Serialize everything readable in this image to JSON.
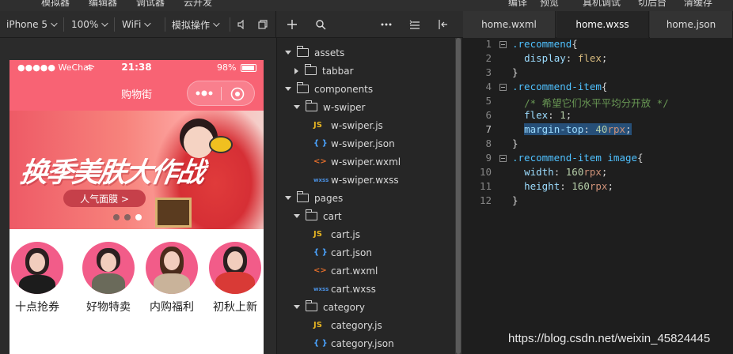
{
  "top_menu": [
    "模拟器",
    "编辑器",
    "调试器",
    "云开发",
    "编译",
    "预览",
    "真机调试",
    "切后台",
    "清缓存"
  ],
  "toolbar": {
    "device": "iPhone 5",
    "zoom": "100%",
    "network": "WiFi",
    "simulate": "模拟操作"
  },
  "tabs": [
    {
      "label": "home.wxml",
      "active": false
    },
    {
      "label": "home.wxss",
      "active": true
    },
    {
      "label": "home.json",
      "active": false
    }
  ],
  "phone": {
    "status": {
      "carrier": "●●●●● WeChat",
      "time": "21:38",
      "battery": "98%"
    },
    "title": "购物街",
    "banner": {
      "headline": "换季美肤大作战",
      "button": "人气面膜 >"
    },
    "recommend": [
      "十点抢券",
      "好物特卖",
      "内购福利",
      "初秋上新"
    ]
  },
  "tree": [
    {
      "label": "assets",
      "type": "folder",
      "open": true,
      "depth": 0
    },
    {
      "label": "tabbar",
      "type": "folder",
      "open": false,
      "depth": 1
    },
    {
      "label": "components",
      "type": "folder",
      "open": true,
      "depth": 0
    },
    {
      "label": "w-swiper",
      "type": "folder",
      "open": true,
      "depth": 1
    },
    {
      "label": "w-swiper.js",
      "type": "js",
      "depth": 2
    },
    {
      "label": "w-swiper.json",
      "type": "json",
      "depth": 2
    },
    {
      "label": "w-swiper.wxml",
      "type": "wxml",
      "depth": 2
    },
    {
      "label": "w-swiper.wxss",
      "type": "wxss",
      "depth": 2
    },
    {
      "label": "pages",
      "type": "folder",
      "open": true,
      "depth": 0
    },
    {
      "label": "cart",
      "type": "folder",
      "open": true,
      "depth": 1
    },
    {
      "label": "cart.js",
      "type": "js",
      "depth": 2
    },
    {
      "label": "cart.json",
      "type": "json",
      "depth": 2
    },
    {
      "label": "cart.wxml",
      "type": "wxml",
      "depth": 2
    },
    {
      "label": "cart.wxss",
      "type": "wxss",
      "depth": 2
    },
    {
      "label": "category",
      "type": "folder",
      "open": true,
      "depth": 1
    },
    {
      "label": "category.js",
      "type": "js",
      "depth": 2
    },
    {
      "label": "category.json",
      "type": "json",
      "depth": 2
    }
  ],
  "code_lines": [
    ".recommend{",
    "  display: flex;",
    "}",
    ".recommend-item{",
    "  /* 希望它们水平平均分开放 */",
    "  flex: 1;",
    "  margin-top: 40rpx;",
    "}",
    ".recommend-item image{",
    "  width: 160rpx;",
    "  height: 160rpx;",
    "}"
  ],
  "watermark": "https://blog.csdn.net/weixin_45824445",
  "colors": {
    "accent": "#f86374",
    "selection": "#264f78"
  }
}
